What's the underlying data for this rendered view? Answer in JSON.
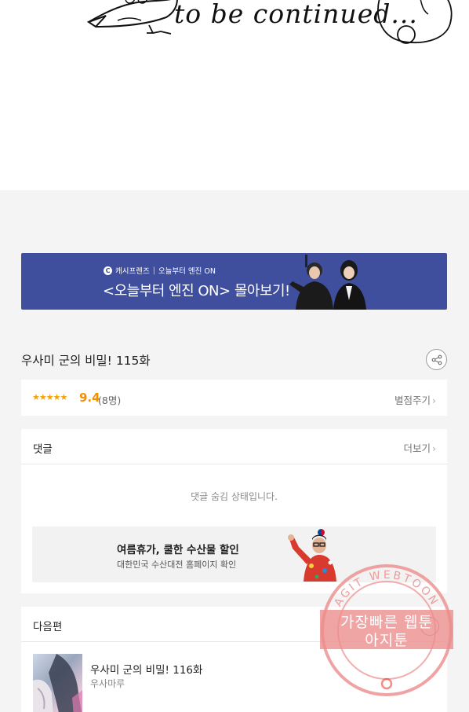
{
  "comic": {
    "caption": "to be continued..."
  },
  "banner_ad": {
    "brand": "캐시프렌즈",
    "brand_tagline": "오늘부터 엔진 ON",
    "headline": "<오늘부터 엔진 ON> 몰아보기!"
  },
  "episode": {
    "title": "우사미 군의 비밀! 115화"
  },
  "rating": {
    "stars": "★★★★★",
    "score": "9.4",
    "count": "(8명)",
    "rate_label": "별점주기",
    "filled_fraction": 0.94
  },
  "comments": {
    "heading": "댓글",
    "more_label": "더보기",
    "hidden_message": "댓글 숨김 상태입니다."
  },
  "comment_ad": {
    "title": "여름휴가, 쿨한 수산물 할인",
    "subtitle": "대한민국 수산대전 홈페이지 확인"
  },
  "next_episode": {
    "heading": "다음편",
    "title": "우사미 군의 비밀! 116화",
    "author": "우사마루"
  },
  "watermark": {
    "line1": "가장빠른 웹툰",
    "line2": "아지툰",
    "ring_text": "AGIT WEBTOON"
  },
  "colors": {
    "banner_bg": "#3f4f9e",
    "star": "#f4a300",
    "watermark": "#ec8c8c"
  }
}
